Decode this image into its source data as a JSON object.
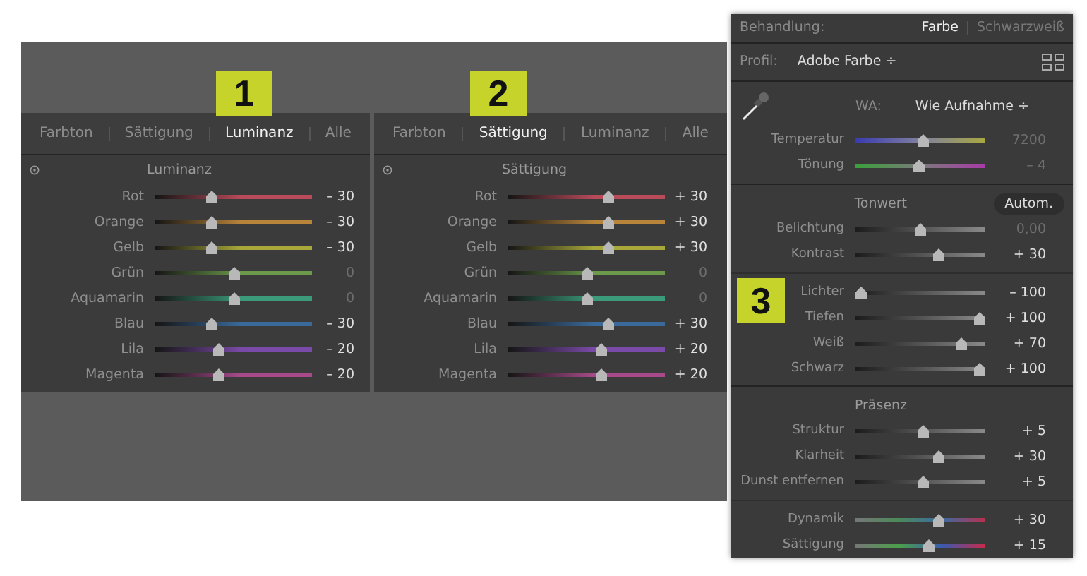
{
  "badges": [
    "1",
    "2",
    "3"
  ],
  "panels": [
    {
      "tabs": [
        {
          "label": "Farbton",
          "selected": false
        },
        {
          "label": "Sättigung",
          "selected": false
        },
        {
          "label": "Luminanz",
          "selected": true
        },
        {
          "label": "Alle",
          "selected": false
        }
      ],
      "title": "Luminanz",
      "sliders": [
        {
          "label": "Rot",
          "value": "– 30",
          "level": 0.35,
          "color": "#b84a5a",
          "muted": false
        },
        {
          "label": "Orange",
          "value": "– 30",
          "level": 0.35,
          "color": "#b8843a",
          "muted": false
        },
        {
          "label": "Gelb",
          "value": "– 30",
          "level": 0.35,
          "color": "#a8a83a",
          "muted": false
        },
        {
          "label": "Grün",
          "value": "0",
          "level": 0.5,
          "color": "#6a9a4a",
          "muted": true
        },
        {
          "label": "Aquamarin",
          "value": "0",
          "level": 0.5,
          "color": "#3a9a7a",
          "muted": true
        },
        {
          "label": "Blau",
          "value": "– 30",
          "level": 0.35,
          "color": "#3a6a9a",
          "muted": false
        },
        {
          "label": "Lila",
          "value": "– 20",
          "level": 0.4,
          "color": "#7a4aa8",
          "muted": false
        },
        {
          "label": "Magenta",
          "value": "– 20",
          "level": 0.4,
          "color": "#a84a8a",
          "muted": false
        }
      ]
    },
    {
      "tabs": [
        {
          "label": "Farbton",
          "selected": false
        },
        {
          "label": "Sättigung",
          "selected": true
        },
        {
          "label": "Luminanz",
          "selected": false
        },
        {
          "label": "Alle",
          "selected": false
        }
      ],
      "title": "Sättigung",
      "sliders": [
        {
          "label": "Rot",
          "value": "+ 30",
          "level": 0.65,
          "color": "#b84a5a",
          "muted": false
        },
        {
          "label": "Orange",
          "value": "+ 30",
          "level": 0.65,
          "color": "#b8843a",
          "muted": false
        },
        {
          "label": "Gelb",
          "value": "+ 30",
          "level": 0.65,
          "color": "#a8a83a",
          "muted": false
        },
        {
          "label": "Grün",
          "value": "0",
          "level": 0.5,
          "color": "#6a9a4a",
          "muted": true
        },
        {
          "label": "Aquamarin",
          "value": "0",
          "level": 0.5,
          "color": "#3a9a7a",
          "muted": true
        },
        {
          "label": "Blau",
          "value": "+ 30",
          "level": 0.65,
          "color": "#3a6a9a",
          "muted": false
        },
        {
          "label": "Lila",
          "value": "+ 20",
          "level": 0.6,
          "color": "#7a4aa8",
          "muted": false
        },
        {
          "label": "Magenta",
          "value": "+ 20",
          "level": 0.6,
          "color": "#a84a8a",
          "muted": false
        }
      ]
    }
  ],
  "develop": {
    "treatment": {
      "label": "Behandlung:",
      "options": [
        {
          "label": "Farbe",
          "selected": true
        },
        {
          "label": "Schwarzweiß",
          "selected": false
        }
      ]
    },
    "profile": {
      "label": "Profil:",
      "value": "Adobe Farbe ÷"
    },
    "white_balance": {
      "label": "WA:",
      "value": "Wie Aufnahme ÷",
      "sliders": [
        {
          "label": "Temperatur",
          "value": "7200",
          "level": 0.52,
          "kind": "temperature",
          "muted": true
        },
        {
          "label": "Tönung",
          "value": "– 4",
          "level": 0.49,
          "kind": "tint",
          "muted": true
        }
      ]
    },
    "tone": {
      "title": "Tonwert",
      "auto_button": "Autom.",
      "sliders": [
        {
          "label": "Belichtung",
          "value": "0,00",
          "level": 0.5,
          "kind": "plain",
          "muted": true
        },
        {
          "label": "Kontrast",
          "value": "+ 30",
          "level": 0.65,
          "kind": "plain",
          "muted": false
        }
      ],
      "sliders_2": [
        {
          "label": "Lichter",
          "value": "– 100",
          "level": 0.0,
          "kind": "plain",
          "muted": false
        },
        {
          "label": "Tiefen",
          "value": "+ 100",
          "level": 1.0,
          "kind": "plain",
          "muted": false
        },
        {
          "label": "Weiß",
          "value": "+ 70",
          "level": 0.85,
          "kind": "plain",
          "muted": false
        },
        {
          "label": "Schwarz",
          "value": "+ 100",
          "level": 1.0,
          "kind": "plain",
          "muted": false
        }
      ]
    },
    "presence": {
      "title": "Präsenz",
      "sliders": [
        {
          "label": "Struktur",
          "value": "+ 5",
          "level": 0.52,
          "kind": "plain",
          "muted": false
        },
        {
          "label": "Klarheit",
          "value": "+ 30",
          "level": 0.65,
          "kind": "plain",
          "muted": false
        },
        {
          "label": "Dunst entfernen",
          "value": "+ 5",
          "level": 0.52,
          "kind": "plain",
          "muted": false
        }
      ],
      "sliders_2": [
        {
          "label": "Dynamik",
          "value": "+ 30",
          "level": 0.65,
          "kind": "vibrance",
          "muted": false
        },
        {
          "label": "Sättigung",
          "value": "+ 15",
          "level": 0.57,
          "kind": "saturation",
          "muted": false
        }
      ]
    }
  }
}
